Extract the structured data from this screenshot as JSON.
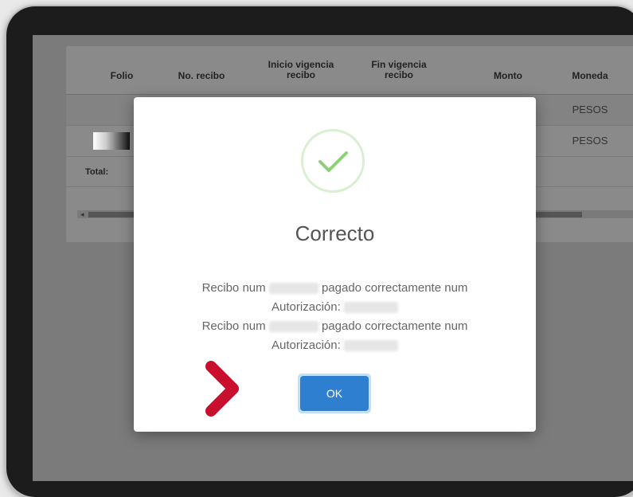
{
  "table": {
    "headers": {
      "folio": "Folio",
      "recibo": "No. recibo",
      "inicio_1": "Inicio vigencia",
      "inicio_2": "recibo",
      "fin_1": "Fin vigencia",
      "fin_2": "recibo",
      "monto": "Monto",
      "moneda": "Moneda"
    },
    "rows": [
      {
        "moneda": "PESOS"
      },
      {
        "moneda": "PESOS"
      }
    ],
    "total_label": "Total:"
  },
  "modal": {
    "title": "Correcto",
    "line1_a": "Recibo num",
    "line1_b": "pagado correctamente num",
    "line2": "Autorización:",
    "line3_a": "Recibo num",
    "line3_b": "pagado correctamente num",
    "line4": "Autorización:",
    "ok_label": "OK",
    "icon": "checkmark-icon",
    "icon_color": "#8ed07a"
  },
  "pointer": {
    "icon": "chevron-right-icon",
    "color": "#c8102e"
  }
}
